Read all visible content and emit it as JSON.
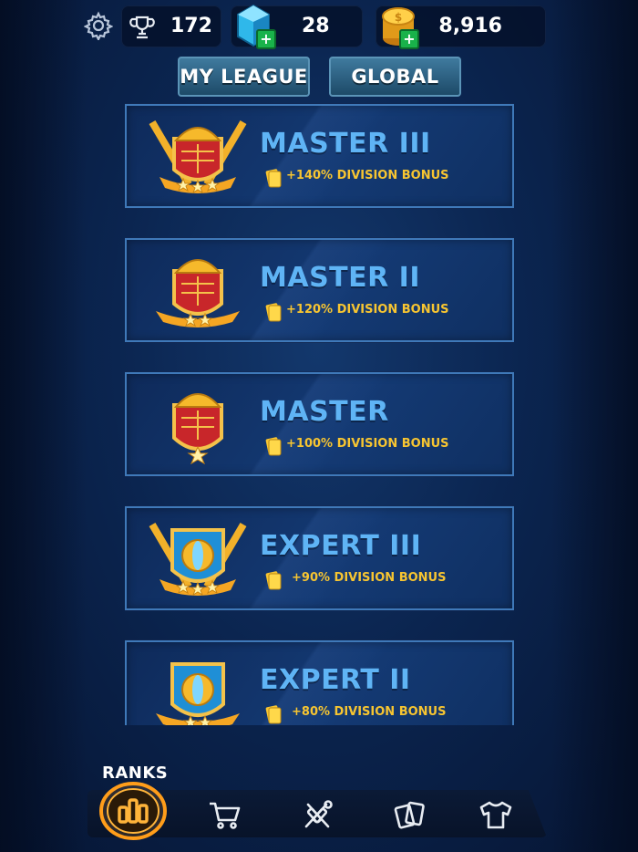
{
  "topbar": {
    "settings_icon": "gear-icon",
    "trophies": "172",
    "gems": "28",
    "coins": "8,916"
  },
  "tabs": [
    {
      "label": "MY LEAGUE"
    },
    {
      "label": "GLOBAL"
    }
  ],
  "divisions": [
    {
      "name": "MASTER III",
      "bonus": "+140%  DIVISION BONUS"
    },
    {
      "name": "MASTER II",
      "bonus": "+120%  DIVISION BONUS"
    },
    {
      "name": "MASTER",
      "bonus": "+100%  DIVISION BONUS"
    },
    {
      "name": "EXPERT III",
      "bonus": "+90%  DIVISION BONUS"
    },
    {
      "name": "EXPERT II",
      "bonus": "+80%  DIVISION BONUS"
    }
  ],
  "nav": {
    "active_label": "RANKS",
    "items": [
      "ranks-icon",
      "shop-cart-icon",
      "cricket-bats-icon",
      "cards-icon",
      "jersey-icon"
    ]
  },
  "colors": {
    "accent_blue": "#5fb4f5",
    "bonus_gold": "#f7c531",
    "active_glow": "#ff9d1a"
  }
}
